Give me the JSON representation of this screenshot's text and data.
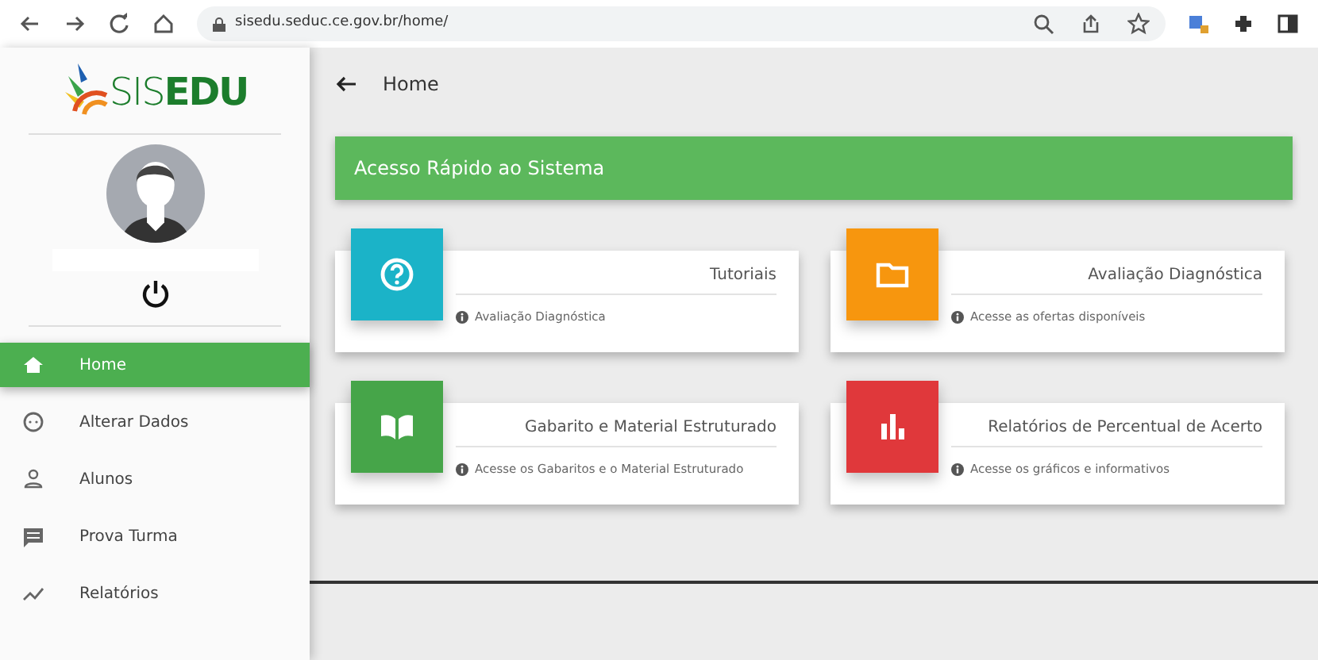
{
  "browser": {
    "url": "sisedu.seduc.ce.gov.br/home/"
  },
  "logo": {
    "light": "SIS",
    "bold": "EDU"
  },
  "sidebar": {
    "items": [
      {
        "label": "Home",
        "selected": true
      },
      {
        "label": "Alterar Dados",
        "selected": false
      },
      {
        "label": "Alunos",
        "selected": false
      },
      {
        "label": "Prova Turma",
        "selected": false
      },
      {
        "label": "Relatórios",
        "selected": false
      }
    ]
  },
  "header": {
    "title": "Home"
  },
  "banner": {
    "title": "Acesso Rápido ao Sistema"
  },
  "cards": [
    {
      "title": "Tutoriais",
      "note": "Avaliação Diagnóstica",
      "color": "#1bb3c8"
    },
    {
      "title": "Avaliação Diagnóstica",
      "note": "Acesse as ofertas disponíveis",
      "color": "#f7960e"
    },
    {
      "title": "Gabarito e Material Estruturado",
      "note": "Acesse os Gabaritos e o Material Estruturado",
      "color": "#46a549"
    },
    {
      "title": "Relatórios de Percentual de Acerto",
      "note": "Acesse os gráficos e informativos",
      "color": "#e0383b"
    }
  ]
}
